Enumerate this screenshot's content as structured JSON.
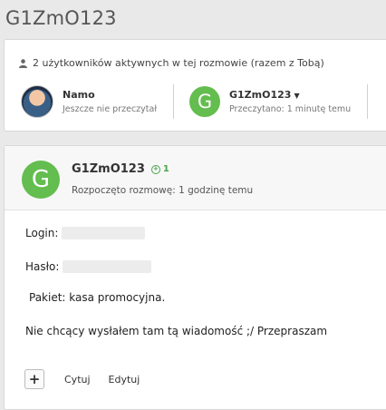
{
  "page": {
    "title": "G1ZmO123"
  },
  "participants": {
    "active_text": "2 użytkowników aktywnych w tej rozmowie (razem z Tobą)",
    "items": [
      {
        "name": "Namo",
        "status": "Jeszcze nie przeczytał",
        "avatar": "photo"
      },
      {
        "name": "G1ZmO123",
        "status": "Przeczytano: 1 minutę temu",
        "avatar_letter": "G",
        "has_dropdown": true
      }
    ]
  },
  "post": {
    "avatar_letter": "G",
    "author": "G1ZmO123",
    "reputation": "1",
    "started": "Rozpoczęto rozmowę: 1 godzinę temu",
    "lines": {
      "login_label": "Login:",
      "haslo_label": "Hasło:",
      "pakiet": "Pakiet: kasa promocyjna.",
      "message": "Nie chcący wysłałem tam tą wiadomość ;/ Przepraszam"
    },
    "actions": {
      "plus": "+",
      "quote": "Cytuj",
      "edit": "Edytuj"
    }
  },
  "colors": {
    "avatar_green": "#63bd4f",
    "rep_green": "#4aa34a",
    "background": "#e9e9e9"
  }
}
